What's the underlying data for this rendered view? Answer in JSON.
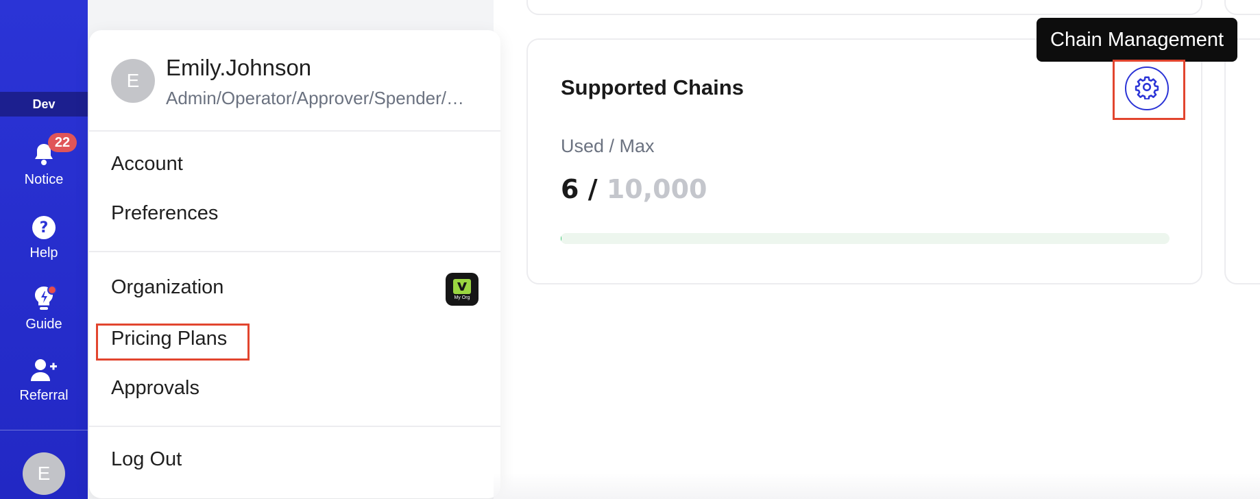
{
  "sidebar": {
    "env": "Dev",
    "notice": {
      "label": "Notice",
      "count": "22"
    },
    "help": {
      "label": "Help"
    },
    "guide": {
      "label": "Guide"
    },
    "referral": {
      "label": "Referral"
    },
    "avatar_initial": "E",
    "icons": [
      "bell-icon",
      "help-icon",
      "lightbulb-icon",
      "add-user-icon"
    ],
    "colors": {
      "bg": "#2b34d6",
      "badge": "#e05558"
    }
  },
  "user_menu": {
    "avatar_initial": "E",
    "name": "Emily.Johnson",
    "role": "Admin/Operator/Approver/Spender/Viewer",
    "items": {
      "account": "Account",
      "preferences": "Preferences",
      "organization": "Organization",
      "org_logo_text": "My Org",
      "pricing_plans": "Pricing Plans",
      "approvals": "Approvals",
      "logout": "Log Out"
    }
  },
  "card": {
    "title": "Supported Chains",
    "subtitle": "Used / Max",
    "used": "6",
    "separator": "/",
    "max": "10,000",
    "progress_fraction": 0.0006,
    "settings_icon": "gear-icon",
    "tooltip": "Chain Management",
    "accent": "#2b34d6"
  }
}
